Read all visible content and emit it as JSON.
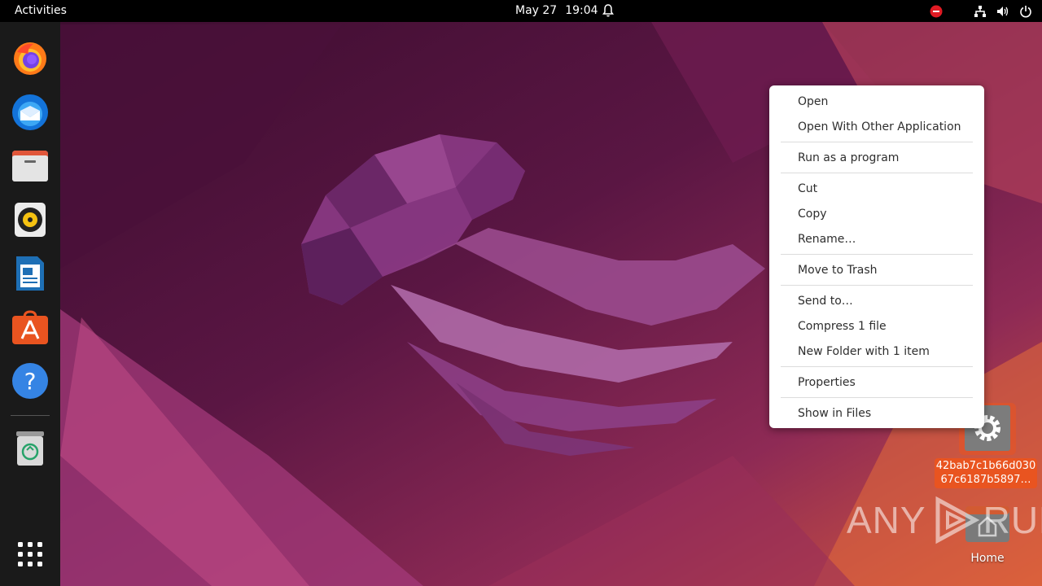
{
  "topbar": {
    "activities": "Activities",
    "date": "May 27",
    "time": "19:04"
  },
  "dock": {
    "items": [
      {
        "name": "firefox-icon"
      },
      {
        "name": "thunderbird-icon"
      },
      {
        "name": "files-icon"
      },
      {
        "name": "rhythmbox-icon"
      },
      {
        "name": "libreoffice-writer-icon"
      },
      {
        "name": "app-center-icon"
      },
      {
        "name": "help-icon"
      },
      {
        "name": "trash-icon"
      },
      {
        "name": "show-apps-icon"
      }
    ]
  },
  "context_menu": {
    "items": [
      "Open",
      "Open With Other Application",
      "Run as a program",
      "Cut",
      "Copy",
      "Rename…",
      "Move to Trash",
      "Send to…",
      "Compress 1 file",
      "New Folder with 1 item",
      "Properties",
      "Show in Files"
    ]
  },
  "desktop": {
    "file_label": "42bab7c1b66d03067c6187b5897…",
    "home_label": "Home"
  },
  "watermark": {
    "left": "ANY",
    "right": "RUN"
  },
  "colors": {
    "accent": "#e95420",
    "topbar": "#000000",
    "dock": "#1a1a1a"
  }
}
